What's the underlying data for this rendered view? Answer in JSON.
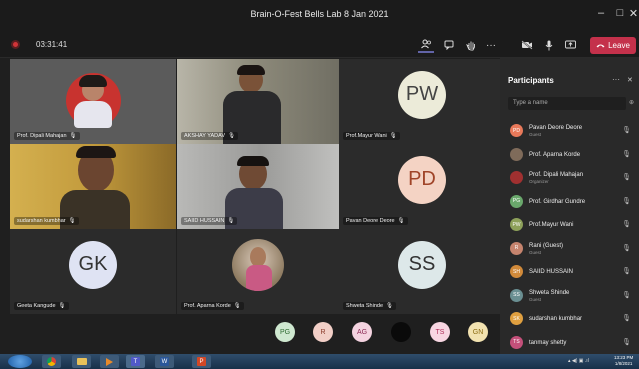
{
  "window": {
    "title": "Brain-O-Fest Bells Lab 8 Jan 2021",
    "minimize": "–",
    "maximize": "□",
    "close": "✕"
  },
  "callbar": {
    "timer": "03:31:41",
    "leave_label": "Leave"
  },
  "tiles": [
    {
      "label": "Prof. Dipali Mahajan",
      "kind": "video",
      "bg": "#5a5a5a"
    },
    {
      "label": "AKSHAY YADAV",
      "kind": "video",
      "bg": "#8b8a7a"
    },
    {
      "label": "Prof.Mayur Wani",
      "kind": "initials",
      "initials": "PW",
      "color": "#ecebd9",
      "text_color": "#444"
    },
    {
      "label": "sudarshan kumbhar",
      "kind": "video",
      "bg": "#c29a3c"
    },
    {
      "label": "SAIID HUSSAIN",
      "kind": "video",
      "bg": "#9a9a98"
    },
    {
      "label": "Pavan Deore Deore",
      "kind": "initials",
      "initials": "PD",
      "color": "#f4d3c4",
      "text_color": "#a04428"
    },
    {
      "label": "Geeta Kangude",
      "kind": "initials",
      "initials": "GK",
      "color": "#dfe3f3",
      "text_color": "#333"
    },
    {
      "label": "Prof. Aparna Korde",
      "kind": "photo",
      "bg": "#2b2b2b"
    },
    {
      "label": "Shweta Shinde",
      "kind": "initials",
      "initials": "SS",
      "color": "#dde8e9",
      "text_color": "#333"
    }
  ],
  "mini_avatars": [
    {
      "text": "PG",
      "color": "#cfe8d0",
      "text_color": "#2f6a31"
    },
    {
      "text": "R",
      "color": "#f2cfc7",
      "text_color": "#8a3a2a"
    },
    {
      "text": "AG",
      "color": "#f4d3e0",
      "text_color": "#8c2a55"
    },
    {
      "text": "",
      "color": "#0a0a0a",
      "text_color": "#fff"
    },
    {
      "text": "TS",
      "color": "#f8d6e2",
      "text_color": "#b0305a"
    },
    {
      "text": "GN",
      "color": "#f2e2b0",
      "text_color": "#8a6a10"
    }
  ],
  "panel": {
    "title": "Participants",
    "more": "···",
    "close": "✕",
    "search_placeholder": "Type a name",
    "participants": [
      {
        "name": "Pavan Deore Deore",
        "role": "Guest",
        "avatar": "PD",
        "color": "#e8795a"
      },
      {
        "name": "Prof. Aparna Korde",
        "role": "",
        "avatar": "",
        "color": "#7f6b5a"
      },
      {
        "name": "Prof. Dipali Mahajan",
        "role": "Organizer",
        "avatar": "",
        "color": "#a03030"
      },
      {
        "name": "Prof. Girdhar Gundre",
        "role": "",
        "avatar": "PG",
        "color": "#6aa86c"
      },
      {
        "name": "Prof.Mayur Wani",
        "role": "",
        "avatar": "PW",
        "color": "#8da05a"
      },
      {
        "name": "Rani (Guest)",
        "role": "Guest",
        "avatar": "R",
        "color": "#c6846e"
      },
      {
        "name": "SAIID HUSSAIN",
        "role": "",
        "avatar": "SH",
        "color": "#d18a3a"
      },
      {
        "name": "Shweta Shinde",
        "role": "Guest",
        "avatar": "SS",
        "color": "#6a8f92"
      },
      {
        "name": "sudarshan kumbhar",
        "role": "",
        "avatar": "SK",
        "color": "#e0a040"
      },
      {
        "name": "tanmay shetty",
        "role": "",
        "avatar": "TS",
        "color": "#c4507a"
      }
    ]
  },
  "taskbar": {
    "time": "13:23 PM",
    "date": "1/8/2021"
  }
}
